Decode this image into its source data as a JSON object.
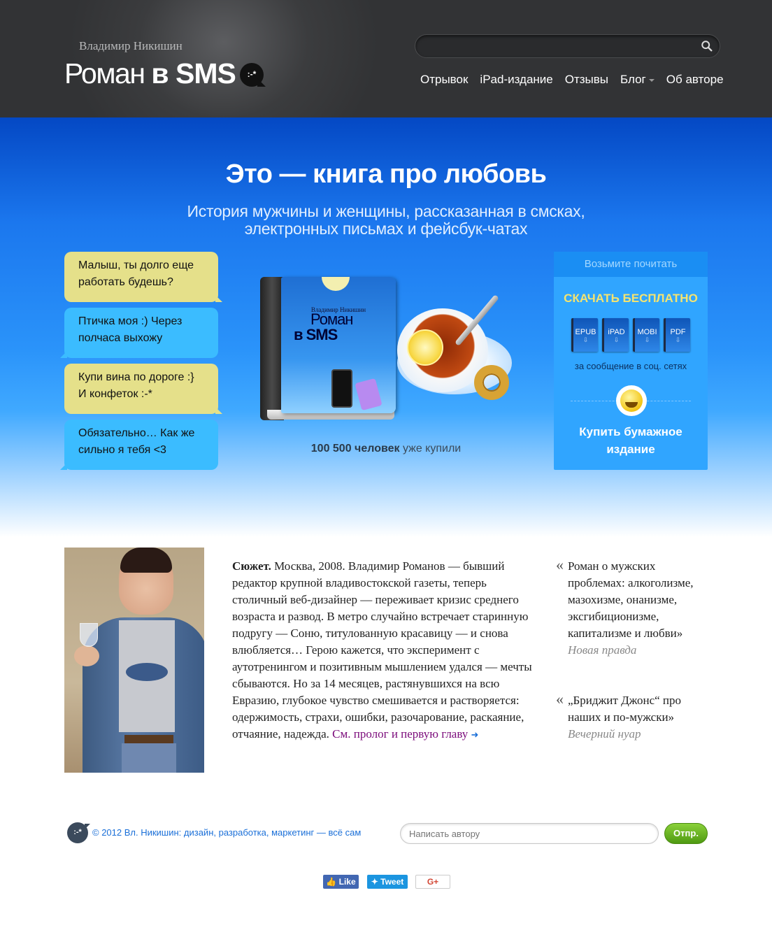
{
  "header": {
    "author": "Владимир Никишин",
    "logo_prefix": "Роман ",
    "logo_bold": "в SMS",
    "logo_bubble": ":-*",
    "search_placeholder": "",
    "nav": [
      "Отрывок",
      "iPad-издание",
      "Отзывы",
      "Блог",
      "Об авторе"
    ]
  },
  "hero": {
    "title": "Это — книга про любовь",
    "subtitle_line1": "История мужчины и женщины, рассказанная в смсках,",
    "subtitle_line2": "электронных письмах и фейсбук-чатах",
    "messages": [
      {
        "text": "Малыш, ты долго еще работать будешь?",
        "color": "yellow"
      },
      {
        "text": "Птичка моя :) Через полчаса выхожу",
        "color": "blue"
      },
      {
        "text": "Купи вина по дороге :} И конфеток :-*",
        "color": "yellow"
      },
      {
        "text": "Обязательно… Как же сильно я тебя <3",
        "color": "blue"
      }
    ],
    "cover": {
      "author": "Владимир Никишин",
      "title_line1": "Роман",
      "title_line2": "в SMS"
    },
    "sold_bold": "100 500 человек",
    "sold_rest": " уже купили"
  },
  "download": {
    "header": "Возьмите почитать",
    "title": "СКАЧАТЬ БЕСПЛАТНО",
    "formats": [
      "EPUB",
      "iPAD",
      "MOBI",
      "PDF"
    ],
    "note": "за сообщение в соц. сетях",
    "buy_line1": "Купить бумажное",
    "buy_line2": "издание"
  },
  "content": {
    "plot_label": "Сюжет.",
    "plot_text": " Москва, 2008. Владимир Романов — бывший редактор крупной владивостокской газеты, теперь столичный веб-дизайнер — переживает кризис среднего возраста и развод. В метро случайно встречает старинную подругу — Соню, титулованную красавицу — и снова влюбляется… Герою кажется, что эксперимент с аутотренингом и позитивным мышлением удался — мечты сбываются. Но за 14 месяцев, растянувшихся на всю Евразию, глубокое чувство смешивается и растворяется: одержимость, страхи, ошибки, разочарование, раскаяние, отчаяние, надежда. ",
    "plot_link": "См. пролог и первую главу",
    "quotes": [
      {
        "mark": "«",
        "text": "Роман о мужских проблемах: алкоголизме, мазохизме, онанизме, эксгибиционизме, капитализме и любви»",
        "source": "Новая правда"
      },
      {
        "mark": "«",
        "text": "„Бриджит Джонс“ про наших и по-мужски»",
        "source": "Вечерний нуар"
      }
    ]
  },
  "footer": {
    "icon": ":-*",
    "copyright": "© 2012 Вл. Никишин: дизайн, разработка, маркетинг — всё сам",
    "input_placeholder": "Написать автору",
    "send": "Отпр.",
    "social": {
      "like": "Like",
      "tweet": "Tweet",
      "gplus": "G+"
    }
  },
  "colors": {
    "header_bg": "#3b3c3e",
    "hero_top": "#0448c4",
    "download_box": "#30a5ff",
    "link": "#1a6fd8",
    "send_button": "#6bb626"
  }
}
